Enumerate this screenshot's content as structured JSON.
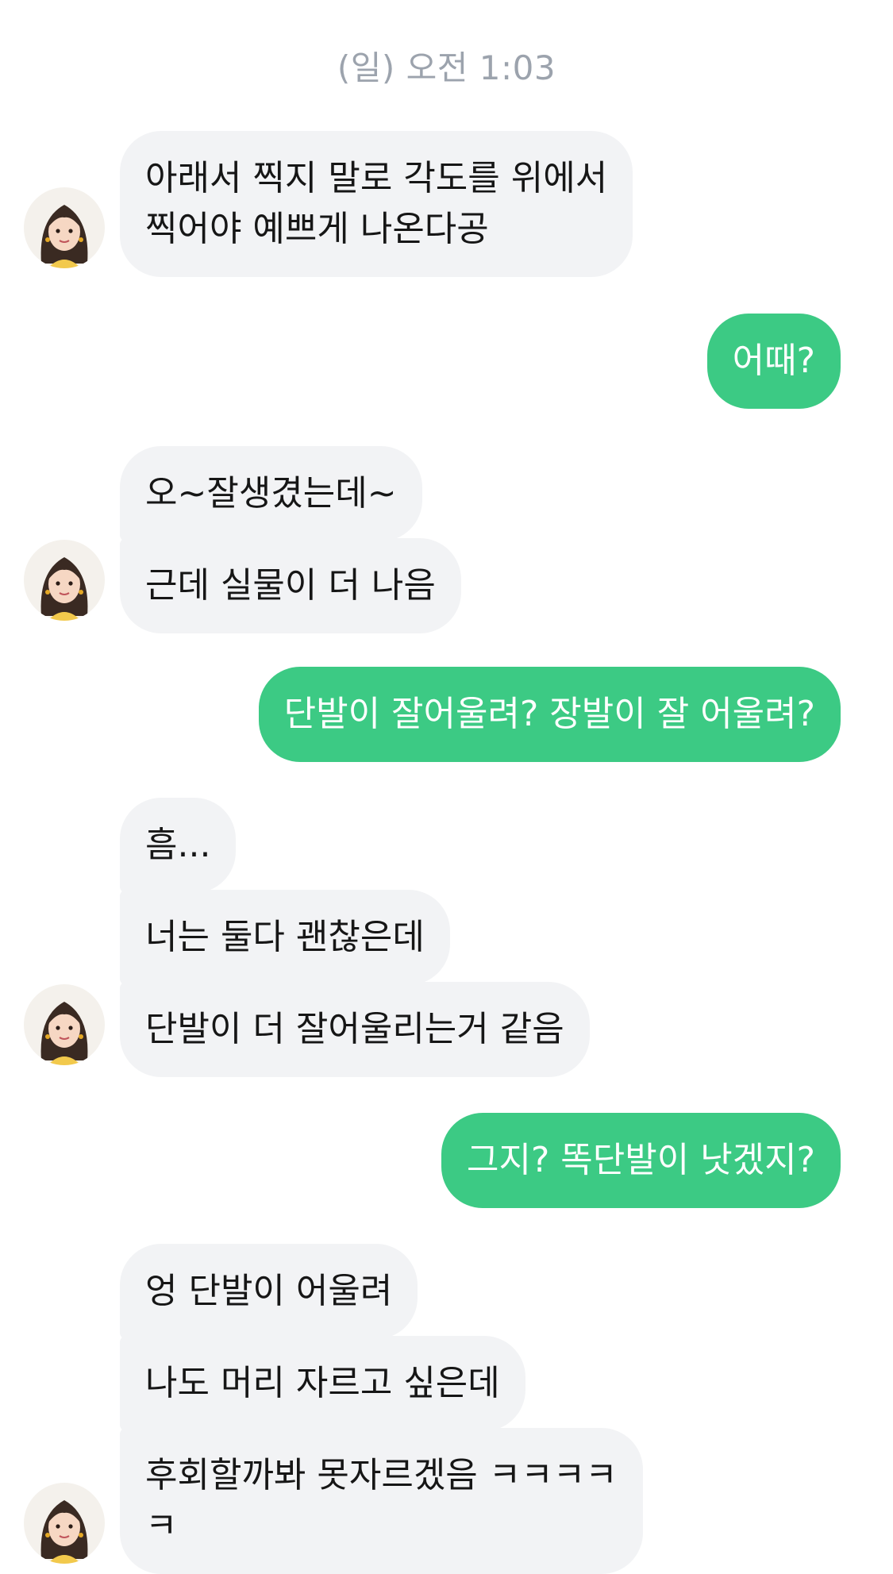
{
  "chat": {
    "timestamp": "(일) 오전 1:03",
    "messages": [
      {
        "from": "them",
        "text_lines": [
          "아래서 찍지 말로 각도를 위에서",
          "찍어야 예쁘게 나온다공"
        ]
      },
      {
        "from": "me",
        "text": "어때?"
      },
      {
        "from": "them",
        "text": "오~잘생겼는데~"
      },
      {
        "from": "them",
        "text": "근데 실물이 더 나음"
      },
      {
        "from": "me",
        "text": "단발이 잘어울려? 장발이 잘 어울려?"
      },
      {
        "from": "them",
        "text": "흠..."
      },
      {
        "from": "them",
        "text": "너는 둘다 괜찮은데"
      },
      {
        "from": "them",
        "text": "단발이 더 잘어울리는거 같음"
      },
      {
        "from": "me",
        "text": "그지? 똑단발이 낫겠지?"
      },
      {
        "from": "them",
        "text": "엉 단발이 어울려"
      },
      {
        "from": "them",
        "text": "나도 머리 자르고 싶은데"
      },
      {
        "from": "them",
        "text_lines": [
          "후회할까봐 못자르겠음 ㅋㅋㅋㅋ",
          "ㅋ"
        ]
      }
    ]
  },
  "avatar": {
    "icon": "girl-portrait-avatar"
  },
  "colors": {
    "outgoing_bubble": "#3cca84",
    "incoming_bubble": "#f2f3f5",
    "timestamp_text": "#9ca3ad"
  }
}
